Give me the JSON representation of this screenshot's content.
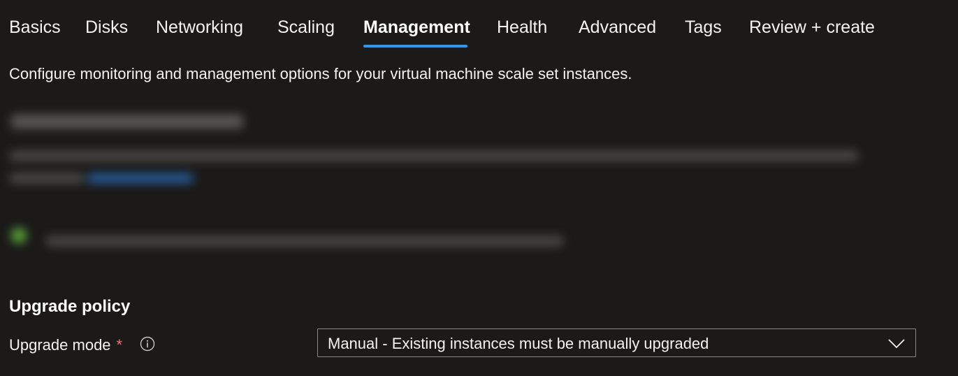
{
  "tabs": [
    {
      "label": "Basics",
      "active": false
    },
    {
      "label": "Disks",
      "active": false
    },
    {
      "label": "Networking",
      "active": false
    },
    {
      "label": "Scaling",
      "active": false
    },
    {
      "label": "Management",
      "active": true
    },
    {
      "label": "Health",
      "active": false
    },
    {
      "label": "Advanced",
      "active": false
    },
    {
      "label": "Tags",
      "active": false
    },
    {
      "label": "Review + create",
      "active": false
    }
  ],
  "description": "Configure monitoring and management options for your virtual machine scale set instances.",
  "upgrade_policy": {
    "heading": "Upgrade policy",
    "upgrade_mode": {
      "label": "Upgrade mode",
      "required_marker": "*",
      "info_icon": "info-icon",
      "selected_value": "Manual - Existing instances must be manually upgraded",
      "dropdown_icon": "chevron-down-icon"
    }
  },
  "colors": {
    "background": "#1b1a19",
    "accent": "#2899f5",
    "required": "#f1707b",
    "border": "#8a8886"
  }
}
